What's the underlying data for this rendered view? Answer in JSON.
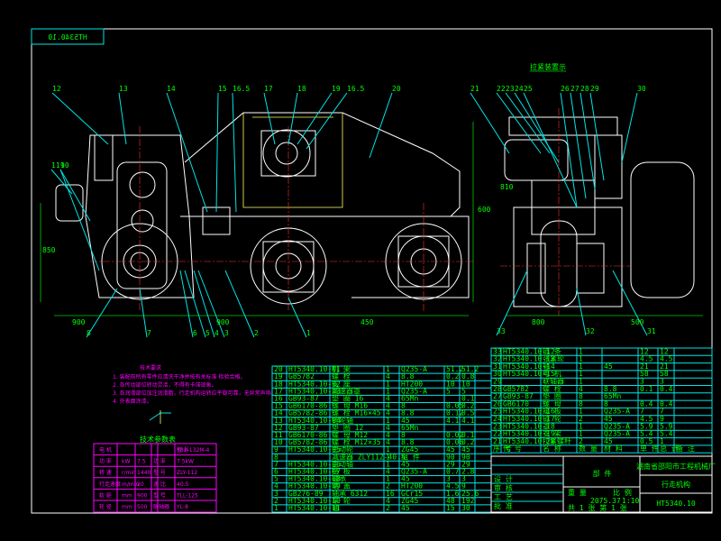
{
  "drawing_number": "HT5340.10",
  "section_label": "拉紧装置示",
  "callouts_top_left": [
    "12",
    "13",
    "14",
    "15",
    "16.5",
    "17",
    "18",
    "19",
    "16.5",
    "20"
  ],
  "callouts_left": [
    "11",
    "10",
    "9"
  ],
  "callouts_bottom": [
    "8",
    "7",
    "6",
    "5",
    "4",
    "3",
    "2",
    "1"
  ],
  "callouts_top_right": [
    "21",
    "22",
    "23",
    "24",
    "25",
    "26",
    "27",
    "28",
    "29",
    "30"
  ],
  "callouts_bottom_right": [
    "33",
    "32",
    "31"
  ],
  "dimensions": [
    "850",
    "900",
    "900",
    "450",
    "600",
    "810",
    "800",
    "500"
  ],
  "tech_notes": {
    "title": "技术要求",
    "lines": [
      "1. 装配前所有零件应清洗干净并按有关标准 检验合格。",
      "2. 各传动部位转动灵活，不得有卡滞现象。",
      "3. 各润滑部位加注润滑脂，行走机构运转应平稳可靠，无异常声响。",
      "4. 外表面涂漆。"
    ]
  },
  "params": {
    "title": "技术参数表",
    "rows": [
      [
        "电 机",
        "",
        "型 号",
        "YB2-132M-4"
      ],
      [
        "功 率",
        "kW",
        "7.5",
        "功 率",
        "7.5kW"
      ],
      [
        "转 速",
        "r/min",
        "1440",
        "型 号",
        "ZLY-112"
      ],
      [
        "行走速度",
        "m/min",
        "20",
        "速 比",
        "40.5"
      ],
      [
        "轨 距",
        "mm",
        "900",
        "型 号",
        "TLL-125"
      ],
      [
        "轮 径",
        "mm",
        "500",
        "联轴器",
        "YL-8"
      ]
    ]
  },
  "bom_left": {
    "rows": [
      [
        "20",
        "HT5340.10-01",
        "机 架",
        "1",
        "Q235-A",
        "51.2",
        "51.2"
      ],
      [
        "19",
        "GB5782",
        "螺 栓",
        "4",
        "8.8",
        "0.2",
        "0.8"
      ],
      [
        "18",
        "HT5340.10-02",
        "支 座",
        "1",
        "HT200",
        "10",
        "10"
      ],
      [
        "17",
        "HT5340.10-03",
        "减速器罩",
        "1",
        "Q235-A",
        "5",
        "5"
      ],
      [
        "16",
        "GB93-87",
        "垫 圈 16",
        "4",
        "65Mn",
        "",
        "0.1"
      ],
      [
        "15",
        "GB6170-86",
        "螺 母 M16",
        "4",
        "8",
        "0.05",
        "0.2"
      ],
      [
        "14",
        "GB5782-86",
        "螺 栓 M16×45",
        "4",
        "8.8",
        "0.12",
        "0.5"
      ],
      [
        "13",
        "HT5340.10-04",
        "链轮轴",
        "1",
        "45",
        "4.1",
        "4.1"
      ],
      [
        "12",
        "GB93-87",
        "垫 圈 12",
        "4",
        "65Mn",
        "",
        ""
      ],
      [
        "11",
        "GB6170-86",
        "螺 母 M12",
        "4",
        "8",
        "0.02",
        "0.1"
      ],
      [
        "10",
        "GB5782-86",
        "螺 栓 M12×35",
        "4",
        "8.8",
        "0.06",
        "0.2"
      ],
      [
        "9",
        "HT5340.10-05",
        "主动轮",
        "1",
        "ZG45",
        "45",
        "45"
      ],
      [
        "8",
        "",
        "减速器 ZLY112-40.5",
        "1",
        "组 件",
        "90",
        "90"
      ],
      [
        "7",
        "HT5340.10-06",
        "主动轴",
        "1",
        "45",
        "29",
        "29"
      ],
      [
        "6",
        "HT5340.10-07",
        "挡 板",
        "4",
        "Q235-A",
        "0.7",
        "2.8"
      ],
      [
        "5",
        "HT5340.10-08",
        "轴承",
        "1",
        "45",
        "3",
        "3"
      ],
      [
        "4",
        "HT5340.10-09",
        "端 盖",
        "2",
        "HT200",
        "4.5",
        "9"
      ],
      [
        "3",
        "GB276-89",
        "轴承 6312",
        "16",
        "GCr15",
        "1.6",
        "25.6"
      ],
      [
        "2",
        "HT5340.10-10",
        "车 轮",
        "4",
        "ZG45",
        "48",
        "192"
      ],
      [
        "1",
        "HT5340.10-11",
        "轴",
        "2",
        "45",
        "15",
        "30"
      ]
    ]
  },
  "bom_right": {
    "rows": [
      [
        "33",
        "HT5340.10-12",
        "链 条",
        "1",
        "",
        "12",
        "12"
      ],
      [
        "32",
        "HT5340.10-13",
        "张紧轮",
        "1",
        "",
        "4.5",
        "4.5"
      ],
      [
        "31",
        "HT5340.10-14",
        "轴",
        "1",
        "45",
        "21",
        "21"
      ],
      [
        "30",
        "HT5340.10-15",
        "电 机",
        "1",
        "",
        "58",
        "58"
      ],
      [
        "29",
        "",
        "联轴器",
        "1",
        "",
        "3",
        "3"
      ],
      [
        "28",
        "GB5782",
        "螺 栓",
        "4",
        "8.8",
        "0.1",
        "0.4"
      ],
      [
        "27",
        "GB93-87",
        "垫 圈",
        "8",
        "65Mn",
        "",
        ""
      ],
      [
        "26",
        "GB6170",
        "螺 母",
        "8",
        "8",
        "0.4",
        "0.4"
      ],
      [
        "25",
        "HT5340.10-16",
        "座 板",
        "1",
        "Q235-A",
        "7",
        "7"
      ],
      [
        "24",
        "HT5340.10-17",
        "链 轮",
        "2",
        "45",
        "4.5",
        "9"
      ],
      [
        "23",
        "HT5340.10-18",
        "罩",
        "1",
        "Q235-A",
        "5.9",
        "5.9"
      ],
      [
        "22",
        "HT5340.10-19",
        "支 架",
        "1",
        "Q235-A",
        "5.4",
        "5.4"
      ],
      [
        "21",
        "HT5340.10-20",
        "拉紧螺杆",
        "2",
        "45",
        "0.5",
        "1"
      ]
    ],
    "header": [
      "序 号",
      "代 号",
      "名 称",
      "数 量",
      "材 料",
      "单 件",
      "总 计",
      "备 注"
    ]
  },
  "title_block": {
    "company": "湖南省邵阳市工程机械厂",
    "part_type": "部 件",
    "name": "行走机构",
    "number": "HT5340.10",
    "scale_label": "比 例",
    "scale": "1:10",
    "weight_label": "重 量",
    "weight": "2075.37",
    "sheet": "共 1 张 第 1 张",
    "roles": [
      "设 计",
      "审 核",
      "工 艺",
      "批 准"
    ]
  },
  "colors": {
    "background": "#000000",
    "frame": "#ffffff",
    "lines": "#00e5e5",
    "text": "#00ff00",
    "notes": "#ff00ff",
    "centerline": "#ff3030",
    "hidden": "#ffff66"
  }
}
